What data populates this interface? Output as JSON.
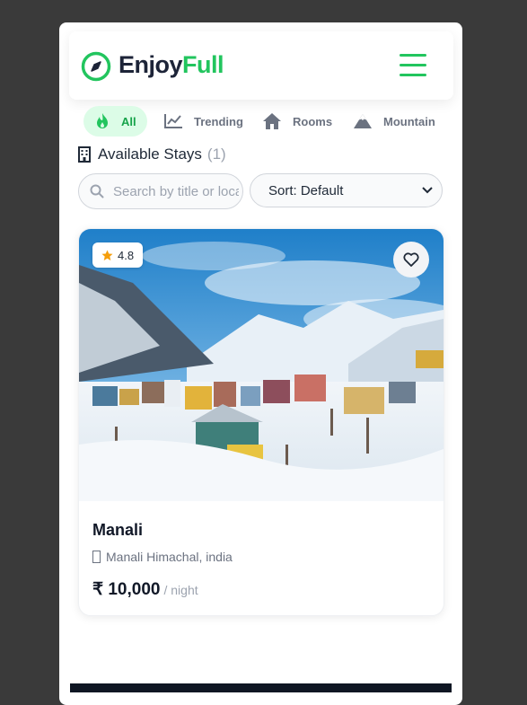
{
  "header": {
    "brand_part1": "Enjoy",
    "brand_part2": "Full",
    "logo_icon": "compass-icon",
    "menu_icon": "hamburger-icon",
    "accent_color": "#22c55e"
  },
  "categories": [
    {
      "label": "All",
      "icon": "flame-icon",
      "active": true
    },
    {
      "label": "Trending",
      "icon": "trending-chart-icon",
      "active": false
    },
    {
      "label": "Rooms",
      "icon": "house-icon",
      "active": false
    },
    {
      "label": "Mountain",
      "icon": "mountain-icon",
      "active": false
    }
  ],
  "listing_header": {
    "label": "Available Stays",
    "count": "(1)",
    "icon": "building-icon"
  },
  "filters": {
    "search_placeholder": "Search by title or location",
    "sort_value": "Sort: Default"
  },
  "listings": [
    {
      "rating": "4.8",
      "title": "Manali",
      "location": "Manali Himachal, india",
      "price": "₹ 10,000",
      "price_unit": "/ night"
    }
  ]
}
